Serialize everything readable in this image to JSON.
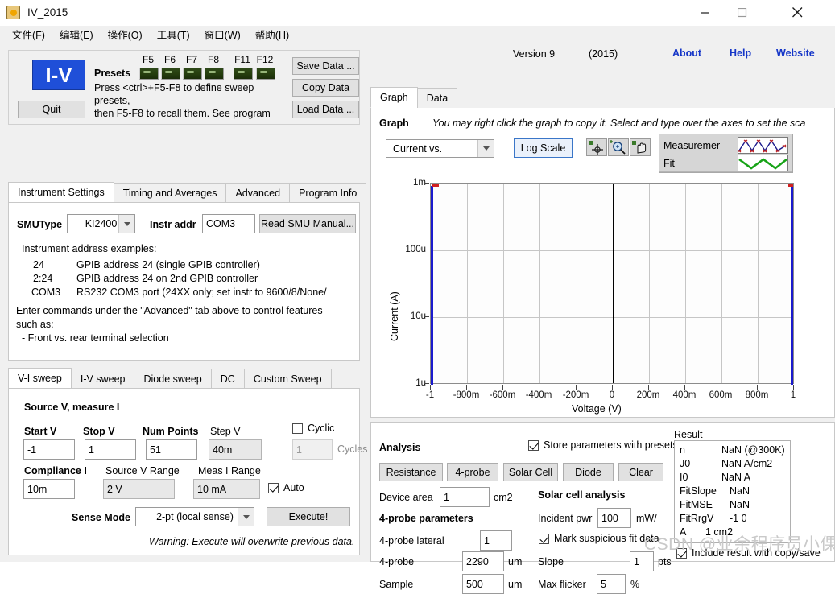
{
  "window": {
    "title": "IV_2015",
    "icon": "app-icon",
    "controls": {
      "minimize": "minimize-icon",
      "maximize": "maximize-icon",
      "close": "close-icon"
    }
  },
  "menubar": [
    {
      "label": "文件(F)"
    },
    {
      "label": "编辑(E)"
    },
    {
      "label": "操作(O)"
    },
    {
      "label": "工具(T)"
    },
    {
      "label": "窗口(W)"
    },
    {
      "label": "帮助(H)"
    }
  ],
  "presets": {
    "logo": "I-V",
    "quit_label": "Quit",
    "presets_label": "Presets",
    "fkeys": [
      "F5",
      "F6",
      "F7",
      "F8",
      "F11",
      "F12"
    ],
    "note_line1": "Press <ctrl>+F5-F8 to define sweep presets,",
    "note_line2": "then F5-F8 to recall them.  See program",
    "save_label": "Save Data ...",
    "copy_label": "Copy Data",
    "load_label": "Load Data ..."
  },
  "instrument": {
    "tabs": [
      {
        "label": "Instrument Settings",
        "active": true
      },
      {
        "label": "Timing and Averages",
        "active": false
      },
      {
        "label": "Advanced",
        "active": false
      },
      {
        "label": "Program Info",
        "active": false
      }
    ],
    "smutype_label": "SMUType",
    "smutype_value": "KI2400",
    "instr_addr_label": "Instr addr",
    "instr_addr_value": "COM3",
    "read_manual_label": "Read SMU Manual...",
    "examples_title": "Instrument address examples:",
    "examples": [
      {
        "key": "24",
        "desc": "GPIB address 24 (single GPIB controller)"
      },
      {
        "key": "2:24",
        "desc": "GPIB address 24 on 2nd GPIB controller"
      },
      {
        "key": "COM3",
        "desc": "RS232 COM3 port (24XX only; set instr to 9600/8/None/"
      }
    ],
    "commands_note1": "Enter commands under the \"Advanced\" tab above to control features",
    "commands_note2": "such as:",
    "commands_note3": "- Front vs. rear terminal selection"
  },
  "sweep": {
    "tabs": [
      {
        "label": "V-I sweep",
        "active": true
      },
      {
        "label": "I-V sweep",
        "active": false
      },
      {
        "label": "Diode sweep",
        "active": false
      },
      {
        "label": "DC",
        "active": false
      },
      {
        "label": "Custom Sweep",
        "active": false
      }
    ],
    "heading": "Source V, measure I",
    "start_v_label": "Start V",
    "start_v_value": "-1",
    "stop_v_label": "Stop V",
    "stop_v_value": "1",
    "num_points_label": "Num Points",
    "num_points_value": "51",
    "step_v_label": "Step V",
    "step_v_value": "40m",
    "cyclic_label": "Cyclic",
    "cyclic_checked": false,
    "cycles_label": "Cycles",
    "cycles_value": "1",
    "compliance_label": "Compliance I",
    "compliance_value": "10m",
    "source_range_label": "Source V Range",
    "source_range_value": "2 V",
    "meas_range_label": "Meas I Range",
    "meas_range_value": "10 mA",
    "auto_label": "Auto",
    "auto_checked": true,
    "sense_mode_label": "Sense Mode",
    "sense_mode_value": "2-pt (local sense)",
    "execute_label": "Execute!",
    "warning": "Warning: Execute will overwrite previous data."
  },
  "graph": {
    "tabs": [
      {
        "label": "Graph",
        "active": true
      },
      {
        "label": "Data",
        "active": false
      }
    ],
    "version": "Version 9",
    "year": "(2015)",
    "links": [
      {
        "label": "About"
      },
      {
        "label": "Help"
      },
      {
        "label": "Website"
      }
    ],
    "graph_word": "Graph",
    "hint": "You may right click the graph to copy it.  Select and type over the axes to set the sca",
    "curve_select_value": "Current vs.",
    "log_scale_label": "Log Scale",
    "tools": [
      "crosshair-cursor-icon",
      "zoom-icon",
      "pan-hand-icon"
    ],
    "legend": [
      {
        "name": "Measuremer",
        "color": "#1a1a8c"
      },
      {
        "name": "Fit",
        "color": "#17a317"
      }
    ],
    "accent_blue": "#1536c8",
    "trace_color": "#1a1acd",
    "marker_color": "#d02020"
  },
  "chart_data": {
    "type": "line",
    "title": "",
    "xlabel": "Voltage (V)",
    "ylabel": "Current (A)",
    "yscale": "log",
    "xlim": [
      -1,
      1
    ],
    "ylim": [
      1e-06,
      0.001
    ],
    "xticks": [
      -1,
      -0.8,
      -0.6,
      -0.4,
      -0.2,
      0,
      0.2,
      0.4,
      0.6,
      0.8,
      1
    ],
    "xticklabels": [
      "-1",
      "-800m",
      "-600m",
      "-400m",
      "-200m",
      "0",
      "200m",
      "400m",
      "600m",
      "800m",
      "1"
    ],
    "yticks": [
      1e-06,
      1e-05,
      0.0001,
      0.001
    ],
    "yticklabels": [
      "1u",
      "10u",
      "100u",
      "1m"
    ],
    "grid": true,
    "legend_position": "outside-top-right",
    "series": [
      {
        "name": "Measurement",
        "color": "#1a1acd",
        "x": [
          -1,
          -1,
          1,
          1
        ],
        "y": [
          1e-06,
          0.001,
          0.001,
          1e-06
        ],
        "note": "Two near-vertical compliance-limited traces at V=-1 and V=+1 spanning 1u to 1m"
      },
      {
        "name": "Fit",
        "color": "#17a317",
        "x": [],
        "y": []
      }
    ],
    "markers": [
      {
        "x": -1,
        "y": 0.001,
        "color": "#d02020"
      },
      {
        "x": 1,
        "y": 0.001,
        "color": "#d02020"
      }
    ],
    "vertical_rule_x": 0
  },
  "analysis": {
    "title": "Analysis",
    "store_label": "Store parameters with presets",
    "store_checked": true,
    "buttons": [
      {
        "label": "Resistance"
      },
      {
        "label": "4-probe"
      },
      {
        "label": "Solar Cell"
      },
      {
        "label": "Diode"
      },
      {
        "label": "Clear"
      }
    ],
    "device_area_label": "Device area",
    "device_area_value": "1",
    "device_area_unit": "cm2",
    "fourprobe_title": "4-probe parameters",
    "fourprobe_lateral_label": "4-probe lateral",
    "fourprobe_lateral_value": "1",
    "fourprobe_label": "4-probe",
    "fourprobe_value": "2290",
    "fourprobe_unit": "um",
    "sample_label": "Sample",
    "sample_value": "500",
    "sample_unit": "um",
    "solar_title": "Solar cell analysis",
    "incident_label": "Incident pwr",
    "incident_value": "100",
    "incident_unit": "mW/",
    "mark_label": "Mark suspicious fit data",
    "mark_checked": true,
    "slope_label": "Slope",
    "slope_value": "1",
    "slope_unit": "pts",
    "flicker_label": "Max flicker",
    "flicker_value": "5",
    "flicker_unit": "%",
    "result_title": "Result",
    "result_lines": [
      {
        "key": "n",
        "value": "NaN (@300K)"
      },
      {
        "key": "J0",
        "value": "NaN A/cm2"
      },
      {
        "key": "I0",
        "value": "NaN A"
      },
      {
        "key": "FitSlope",
        "value": "NaN"
      },
      {
        "key": "FitMSE",
        "value": "NaN"
      },
      {
        "key": "FitRrgV",
        "value": "-1 0"
      },
      {
        "key": "A",
        "value": "1 cm2"
      }
    ],
    "include_label": "Include result with copy/save",
    "include_checked": true
  },
  "watermark": "CSDN @业余程序员小倮"
}
